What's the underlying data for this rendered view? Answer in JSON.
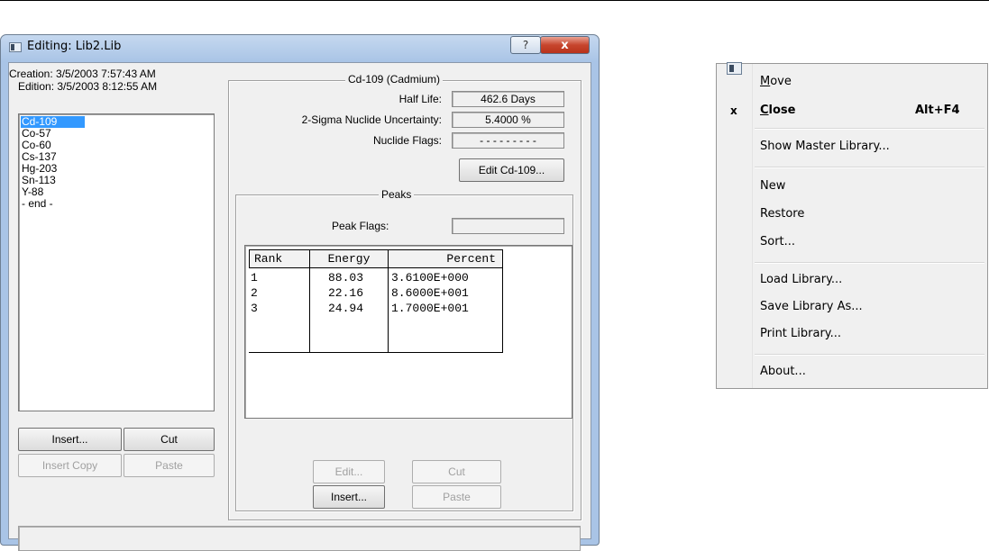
{
  "window": {
    "title": "Editing: Lib2.Lib",
    "help_label": "?",
    "close_label": "x"
  },
  "dates": {
    "creation_label": "Creation:",
    "creation_value": "3/5/2003  7:57:43 AM",
    "edition_label": "Edition:",
    "edition_value": "3/5/2003  8:12:55 AM"
  },
  "nuclides": [
    "Cd-109",
    "Co-57",
    "Co-60",
    "Cs-137",
    "Hg-203",
    "Sn-113",
    "Y-88",
    "- end -"
  ],
  "nuclide_buttons": {
    "insert": "Insert...",
    "cut": "Cut",
    "insert_copy": "Insert Copy",
    "paste": "Paste"
  },
  "nuclide_group": {
    "title": "Cd-109 (Cadmium)",
    "half_life_label": "Half Life:",
    "half_life_value": "462.6 Days",
    "uncertainty_label": "2-Sigma Nuclide Uncertainty:",
    "uncertainty_value": "5.4000 %",
    "flags_label": "Nuclide Flags:",
    "flags_value": "- - - - - - - - -",
    "edit_button": "Edit Cd-109..."
  },
  "peaks_group": {
    "title": "Peaks",
    "flags_label": "Peak Flags:",
    "flags_value": "",
    "columns": [
      "Rank",
      "Energy",
      "Percent"
    ],
    "rows": [
      {
        "rank": "1",
        "energy": "88.03",
        "percent": "3.6100E+000"
      },
      {
        "rank": "2",
        "energy": "22.16",
        "percent": "8.6000E+001"
      },
      {
        "rank": "3",
        "energy": "24.94",
        "percent": "1.7000E+001"
      }
    ],
    "buttons": {
      "edit": "Edit...",
      "cut": "Cut",
      "insert": "Insert...",
      "paste": "Paste"
    }
  },
  "status_text": "",
  "context_menu": {
    "items": [
      {
        "label": "Move",
        "mnemonic": "M",
        "rest": "ove"
      },
      {
        "label": "Close",
        "mnemonic": "C",
        "rest": "lose",
        "shortcut": "Alt+F4",
        "marker": "x"
      },
      {
        "label": "Show Master Library..."
      },
      {
        "label": "New"
      },
      {
        "label": "Restore"
      },
      {
        "label": "Sort..."
      },
      {
        "label": "Load Library..."
      },
      {
        "label": "Save Library As..."
      },
      {
        "label": "Print Library..."
      },
      {
        "label": "About..."
      }
    ]
  }
}
